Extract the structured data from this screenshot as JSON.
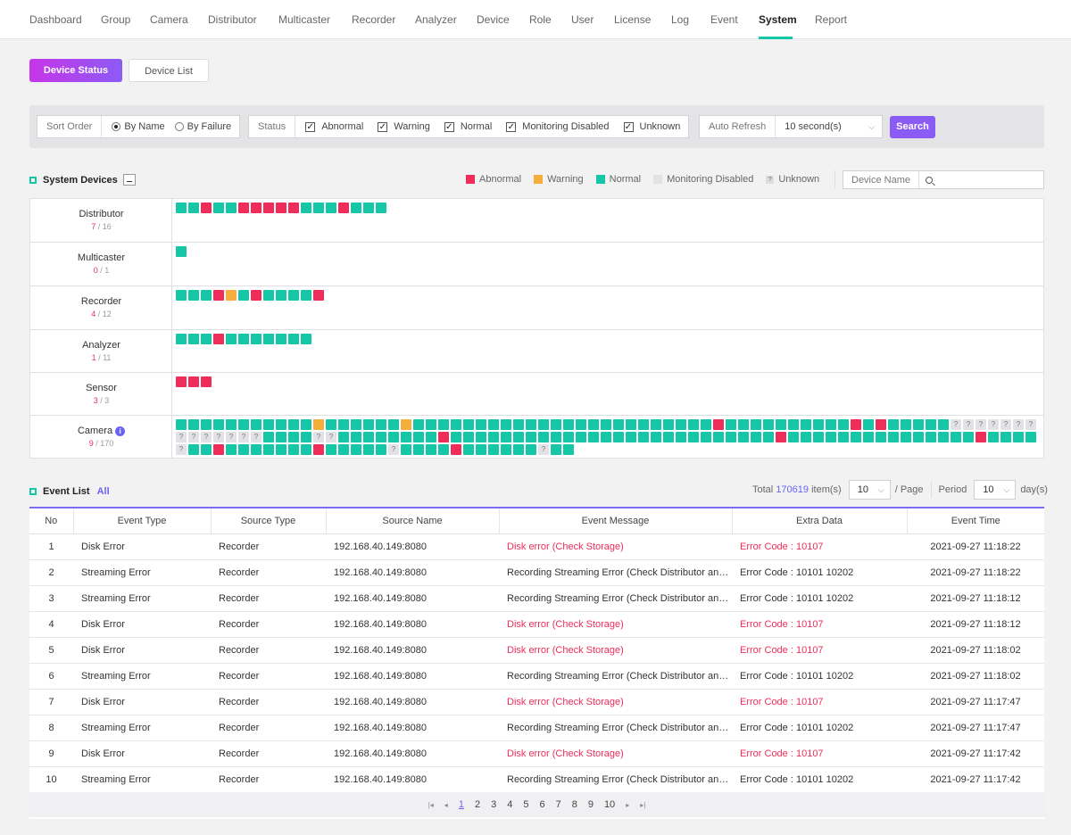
{
  "nav": {
    "items": [
      "Dashboard",
      "Group",
      "Camera",
      "Distributor",
      "Multicaster",
      "Recorder",
      "Analyzer",
      "Device",
      "Role",
      "User",
      "License",
      "Log",
      "Event",
      "System",
      "Report"
    ],
    "active": "System"
  },
  "tabs": {
    "device_status": "Device Status",
    "device_list": "Device List"
  },
  "filters": {
    "sort_order_label": "Sort Order",
    "by_name": "By Name",
    "by_failure": "By Failure",
    "status_label": "Status",
    "abnormal": "Abnormal",
    "warning": "Warning",
    "normal": "Normal",
    "monitoring_disabled": "Monitoring Disabled",
    "unknown": "Unknown",
    "auto_refresh_label": "Auto Refresh",
    "auto_refresh_value": "10 second(s)",
    "search_button": "Search"
  },
  "system_devices": {
    "title": "System Devices",
    "legend": {
      "abnormal": "Abnormal",
      "warning": "Warning",
      "normal": "Normal",
      "monitoring_disabled": "Monitoring Disabled",
      "unknown": "Unknown"
    },
    "device_name_label": "Device Name",
    "rows": [
      {
        "name": "Distributor",
        "bad": "7",
        "total": " / 16",
        "cells": "nnannaaaaannnannn"
      },
      {
        "name": "Multicaster",
        "bad": "0",
        "total": " / 1",
        "cells": "n"
      },
      {
        "name": "Recorder",
        "bad": "4",
        "total": " / 12",
        "cells": "nnnawnannnna"
      },
      {
        "name": "Analyzer",
        "bad": "1",
        "total": " / 11",
        "cells": "nnnannnnnnn"
      },
      {
        "name": "Sensor",
        "bad": "3",
        "total": " / 3",
        "cells": "aaa"
      },
      {
        "name": "Camera",
        "bad": "9",
        "total": " / 170",
        "info": true,
        "cells": "nnnnnnnnnnnwnnnnnnnwnnnnnnnnnnnnnnnnnnnnnnnnnnnnnnnnnnnnnnnnnnnnnnnnnnnnnnnnnnnnnnnnnnnnnnnnnnnnnnnnnnnnnnnnnnnnnnnnnnnnnnnnnnnnnnnnnnnnnnnnnnnnnnnnnnnnnnnnnnnnnnn"
      }
    ],
    "camera_cells": {
      "row1": "nnnnnnnnnnnwnnnnnnnwnnnnnnnnnnnnnnnnnnnnnnnnnnnnnnnnnnnnnnnnnnnnnnnnnnnnnnnnnnnnnnnnnnnnnnnnnnnnnnnnnnnnnnnnnnnnnnnnnnnnnnnnnnnnn",
      "first": "nnnnnnnnnnnwnnnnnnnwnnnnnnnnnnnnnnnnnnnnnnnnnnnnnnnnnnnnnnnnnnnnnnnnnnnnnnnnnnnnnnnnnnnnnnnnnnnnnnnn"
    }
  },
  "event_list": {
    "title": "Event List",
    "all_link": "All",
    "total_label": "Total",
    "total_count": "170619",
    "items_label": "item(s)",
    "per_page_value": "10",
    "per_page_label": "/ Page",
    "period_label": "Period",
    "period_value": "10",
    "period_unit": "day(s)",
    "columns": [
      "No",
      "Event Type",
      "Source Type",
      "Source Name",
      "Event Message",
      "Extra Data",
      "Event Time"
    ],
    "rows": [
      {
        "no": "1",
        "type": "Disk Error",
        "source_type": "Recorder",
        "source_name": "192.168.40.149:8080",
        "message": "Disk error (Check Storage)",
        "extra": "Error Code : 10107",
        "time": "2021-09-27 11:18:22",
        "err": true
      },
      {
        "no": "2",
        "type": "Streaming Error",
        "source_type": "Recorder",
        "source_name": "192.168.40.149:8080",
        "message": "Recording Streaming Error (Check Distributor and...",
        "extra": "Error Code : 10101 10202",
        "time": "2021-09-27 11:18:22",
        "err": false
      },
      {
        "no": "3",
        "type": "Streaming Error",
        "source_type": "Recorder",
        "source_name": "192.168.40.149:8080",
        "message": "Recording Streaming Error (Check Distributor and...",
        "extra": "Error Code : 10101 10202",
        "time": "2021-09-27 11:18:12",
        "err": false
      },
      {
        "no": "4",
        "type": "Disk Error",
        "source_type": "Recorder",
        "source_name": "192.168.40.149:8080",
        "message": "Disk error (Check Storage)",
        "extra": "Error Code : 10107",
        "time": "2021-09-27 11:18:12",
        "err": true
      },
      {
        "no": "5",
        "type": "Disk Error",
        "source_type": "Recorder",
        "source_name": "192.168.40.149:8080",
        "message": "Disk error (Check Storage)",
        "extra": "Error Code : 10107",
        "time": "2021-09-27 11:18:02",
        "err": true
      },
      {
        "no": "6",
        "type": "Streaming Error",
        "source_type": "Recorder",
        "source_name": "192.168.40.149:8080",
        "message": "Recording Streaming Error (Check Distributor and...",
        "extra": "Error Code : 10101 10202",
        "time": "2021-09-27 11:18:02",
        "err": false
      },
      {
        "no": "7",
        "type": "Disk Error",
        "source_type": "Recorder",
        "source_name": "192.168.40.149:8080",
        "message": "Disk error (Check Storage)",
        "extra": "Error Code : 10107",
        "time": "2021-09-27 11:17:47",
        "err": true
      },
      {
        "no": "8",
        "type": "Streaming Error",
        "source_type": "Recorder",
        "source_name": "192.168.40.149:8080",
        "message": "Recording Streaming Error (Check Distributor and...",
        "extra": "Error Code : 10101 10202",
        "time": "2021-09-27 11:17:47",
        "err": false
      },
      {
        "no": "9",
        "type": "Disk Error",
        "source_type": "Recorder",
        "source_name": "192.168.40.149:8080",
        "message": "Disk error (Check Storage)",
        "extra": "Error Code : 10107",
        "time": "2021-09-27 11:17:42",
        "err": true
      },
      {
        "no": "10",
        "type": "Streaming Error",
        "source_type": "Recorder",
        "source_name": "192.168.40.149:8080",
        "message": "Recording Streaming Error (Check Distributor and...",
        "extra": "Error Code : 10101 10202",
        "time": "2021-09-27 11:17:42",
        "err": false
      }
    ],
    "pages": [
      "1",
      "2",
      "3",
      "4",
      "5",
      "6",
      "7",
      "8",
      "9",
      "10"
    ],
    "current_page": "1"
  },
  "colors": {
    "normal": "#16c7a7",
    "abnormal": "#ee2d5b",
    "warning": "#f5ad3c",
    "disabled": "#e1e1e6",
    "accent": "#8b5bf5"
  }
}
